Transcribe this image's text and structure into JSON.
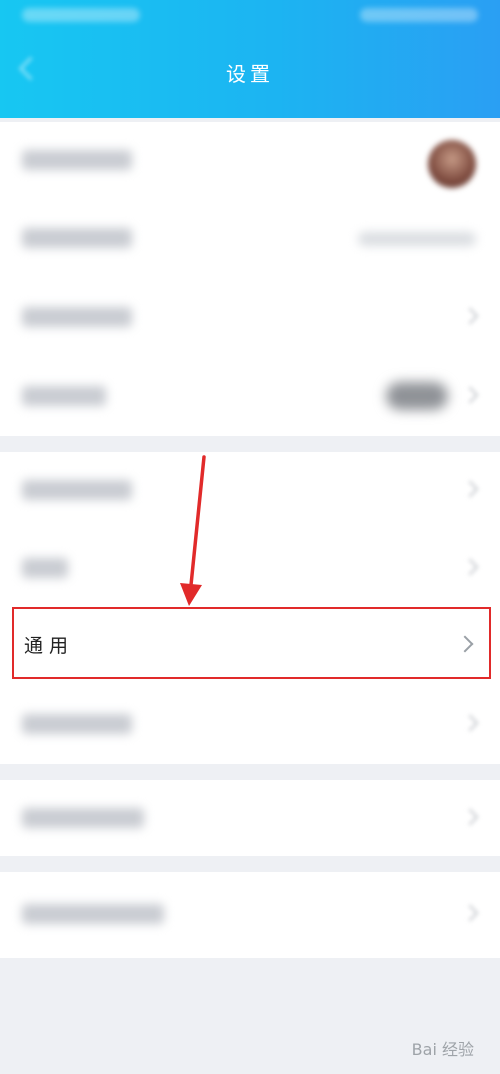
{
  "header": {
    "title": "设置"
  },
  "general_item": {
    "label": "通用",
    "highlight_color": "#e12a2a"
  },
  "colors": {
    "header_start": "#17c7f2",
    "header_end": "#2a9ff3",
    "annotation": "#e12a2a"
  },
  "icons": [
    "back-arrow-icon",
    "chevron-right-icon",
    "annotation-arrow-icon",
    "avatar"
  ],
  "watermark": {
    "text": "Bai 经验"
  }
}
